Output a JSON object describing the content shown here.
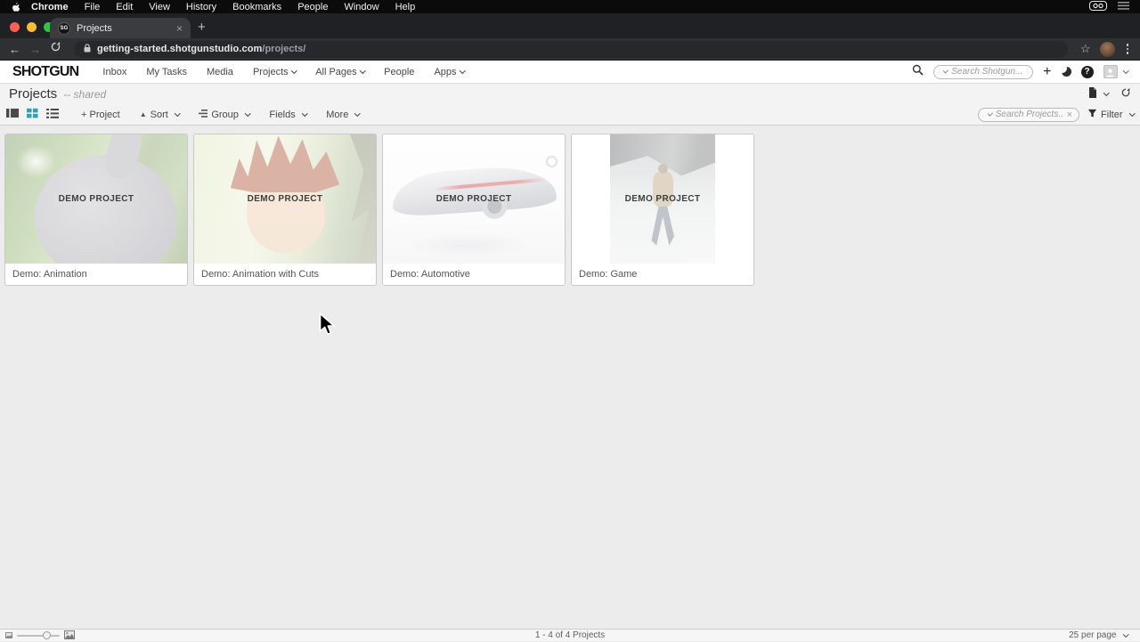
{
  "menubar": {
    "items": [
      "Chrome",
      "File",
      "Edit",
      "View",
      "History",
      "Bookmarks",
      "People",
      "Window",
      "Help"
    ]
  },
  "browser": {
    "tab_title": "Projects",
    "favicon_text": "SG",
    "tab_close": "×",
    "new_tab": "+",
    "back": "←",
    "forward": "→",
    "url_host": "getting-started.shotgunstudio.com",
    "url_path": "/projects/",
    "star": "☆"
  },
  "app_header": {
    "logo": "SHOTGUN",
    "nav": [
      {
        "label": "Inbox"
      },
      {
        "label": "My Tasks"
      },
      {
        "label": "Media"
      },
      {
        "label": "Projects"
      },
      {
        "label": "All Pages"
      },
      {
        "label": "People"
      },
      {
        "label": "Apps"
      }
    ],
    "search_placeholder": "Search Shotgun...",
    "plus": "+",
    "help": "?"
  },
  "page_header": {
    "title": "Projects",
    "subtitle": "-- shared"
  },
  "toolbar": {
    "add_project": "+ Project",
    "sort": "Sort",
    "sort_glyph": "▲",
    "group": "Group",
    "fields": "Fields",
    "more": "More",
    "search_placeholder": "Search Projects...",
    "clear": "×",
    "filter": "Filter"
  },
  "projects": {
    "cards": [
      {
        "title": "Demo: Animation",
        "overlay": "DEMO PROJECT",
        "art": "bunny"
      },
      {
        "title": "Demo: Animation with Cuts",
        "overlay": "DEMO PROJECT",
        "art": "boy"
      },
      {
        "title": "Demo: Automotive",
        "overlay": "DEMO PROJECT",
        "art": "car",
        "badge": true
      },
      {
        "title": "Demo: Game",
        "overlay": "DEMO PROJECT",
        "art": "soldier",
        "portrait": true
      }
    ]
  },
  "statusbar": {
    "range": "1 - 4 of 4 Projects",
    "per_page": "25 per page"
  },
  "colors": {
    "accent_teal": "#35a0b5",
    "mac_red": "#ff5f57",
    "mac_yellow": "#febc2e",
    "mac_green": "#28c840"
  }
}
